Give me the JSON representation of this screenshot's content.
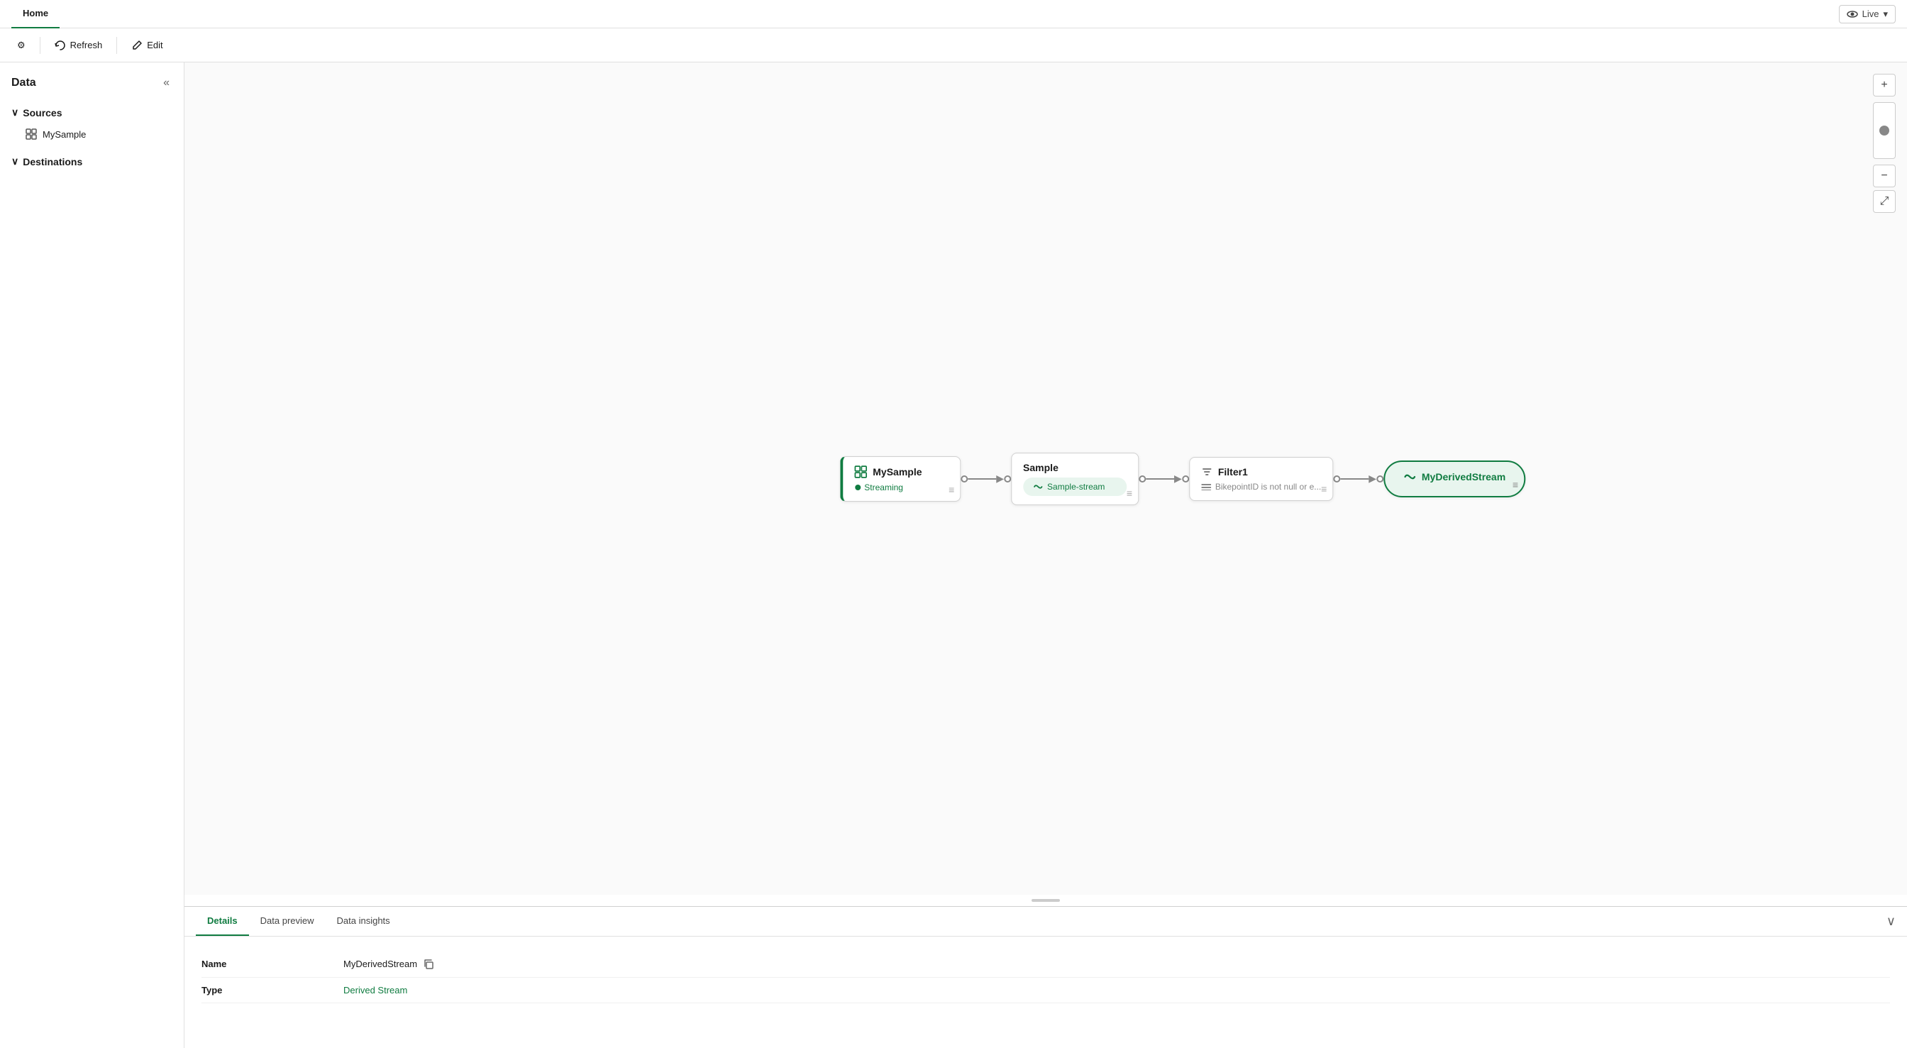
{
  "topNav": {
    "tab": "Home",
    "live_label": "Live",
    "live_icon": "eye-icon"
  },
  "toolbar": {
    "gear_icon": "⚙",
    "refresh_label": "Refresh",
    "refresh_icon": "↻",
    "edit_label": "Edit",
    "edit_icon": "✎"
  },
  "sidebar": {
    "title": "Data",
    "collapse_icon": "«",
    "sources_label": "Sources",
    "sources_chevron": "∨",
    "sources_items": [
      {
        "label": "MySample",
        "icon": "grid-icon"
      }
    ],
    "destinations_label": "Destinations",
    "destinations_chevron": "∨"
  },
  "canvas": {
    "nodes": [
      {
        "id": "mysample",
        "type": "source",
        "title": "MySample",
        "status": "Streaming",
        "icon": "grid-icon"
      },
      {
        "id": "sample",
        "type": "transform",
        "title": "Sample",
        "stream": "Sample-stream",
        "icon": "stream-icon"
      },
      {
        "id": "filter1",
        "type": "filter",
        "title": "Filter1",
        "condition": "BikepointID is not null or e...",
        "icon": "filter-icon"
      },
      {
        "id": "myderivedstream",
        "type": "destination",
        "title": "MyDerivedStream",
        "icon": "stream-icon"
      }
    ],
    "controls": {
      "zoom_in": "+",
      "zoom_out": "−",
      "fit": "⤢"
    }
  },
  "bottomPanel": {
    "tabs": [
      {
        "label": "Details",
        "active": true
      },
      {
        "label": "Data preview",
        "active": false
      },
      {
        "label": "Data insights",
        "active": false
      }
    ],
    "collapse_icon": "∨",
    "details": {
      "name_label": "Name",
      "name_value": "MyDerivedStream",
      "copy_icon": "copy-icon",
      "type_label": "Type",
      "type_value": "Derived Stream"
    }
  }
}
